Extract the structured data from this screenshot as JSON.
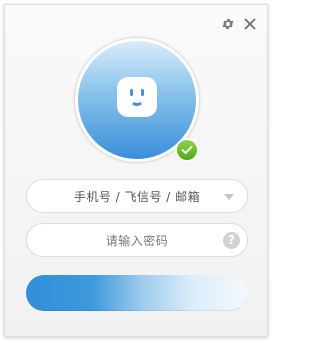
{
  "window": {
    "settings_icon": "gear-icon",
    "close_icon": "close-icon"
  },
  "avatar": {
    "face_icon": "smiley-face-icon",
    "status_icon": "check-icon",
    "status_color": "#5fb726"
  },
  "account_field": {
    "value": "手机号 / 飞信号 / 邮箱",
    "arrow_icon": "chevron-down-icon"
  },
  "password_field": {
    "placeholder": "请输入密码",
    "help_icon": "help-icon",
    "help_glyph": "?"
  },
  "login_button": {
    "label": "",
    "color": "#2f8fd8"
  }
}
